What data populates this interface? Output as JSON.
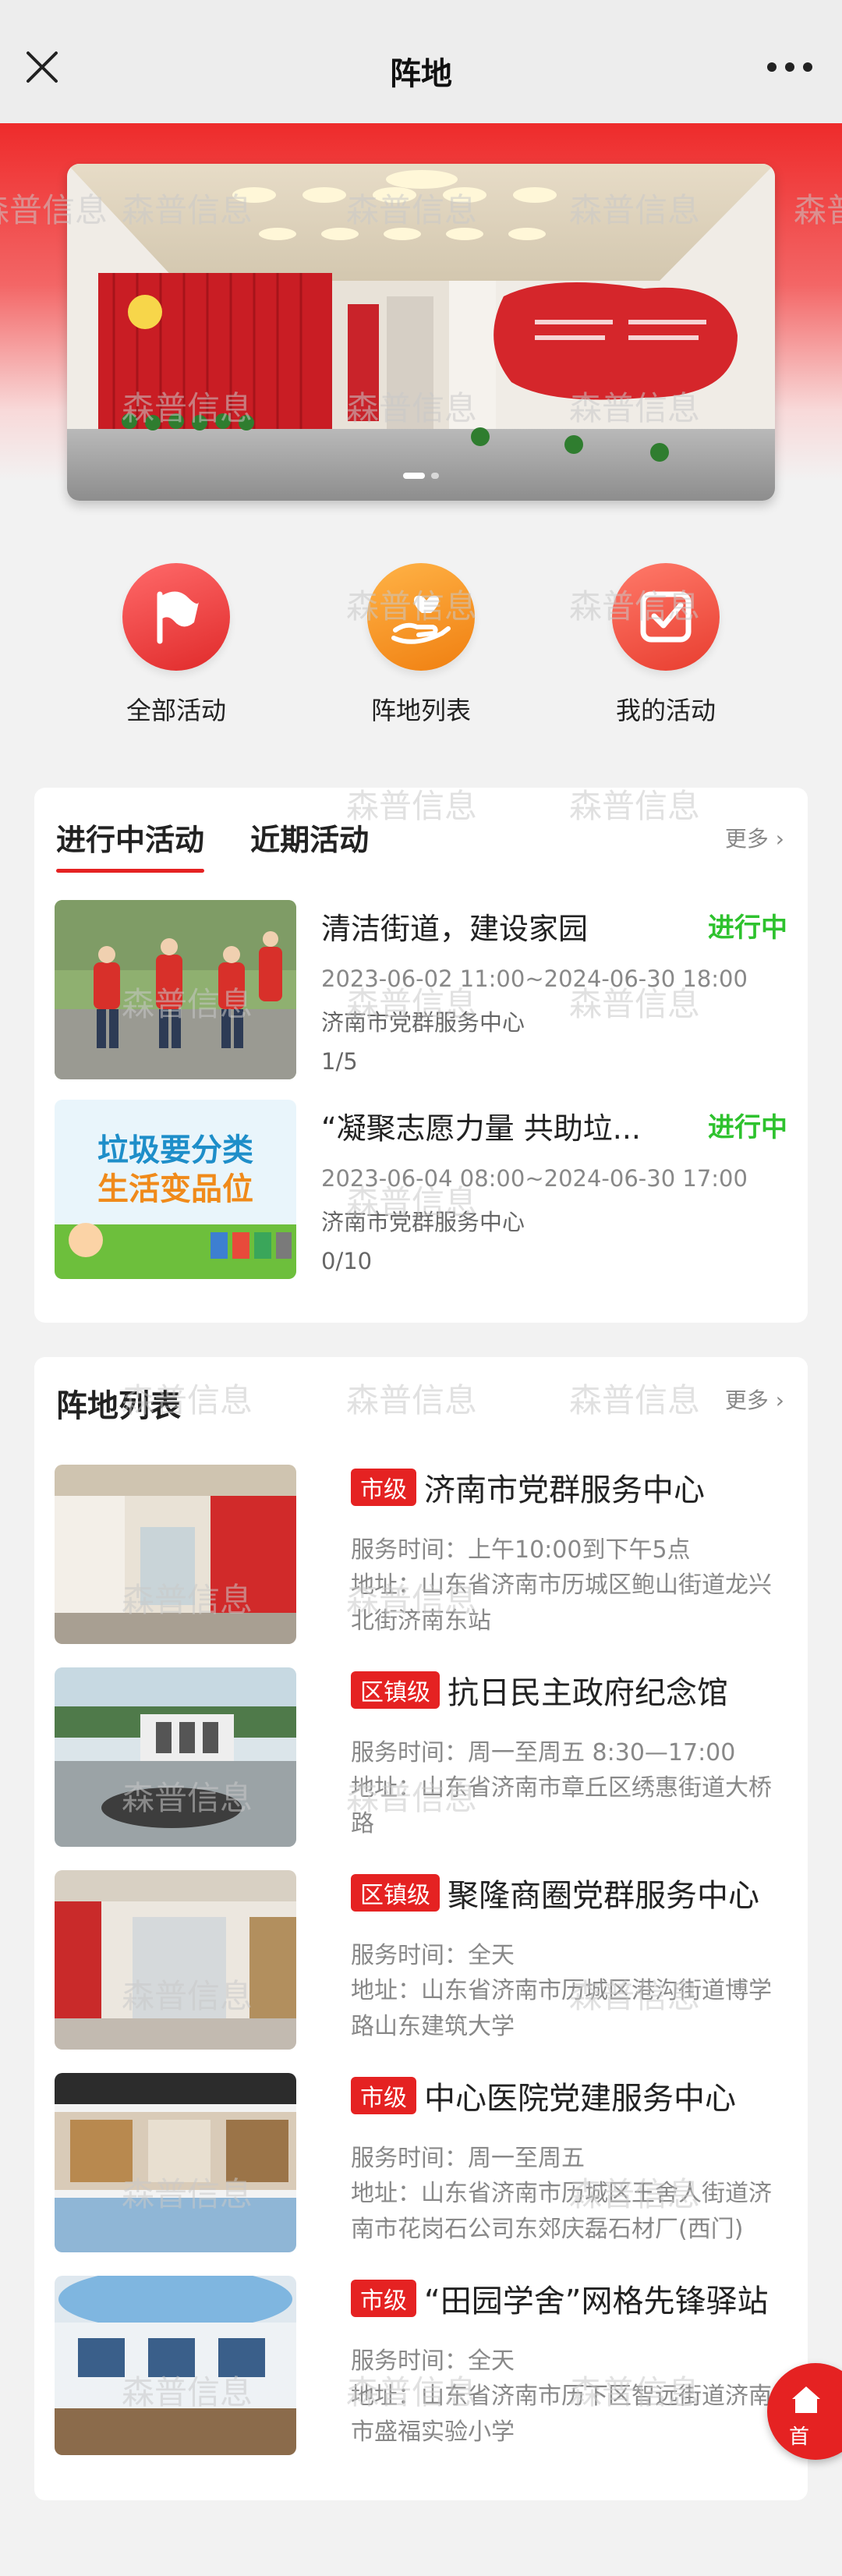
{
  "nav": {
    "title": "阵地"
  },
  "watermark": {
    "text": "森普信息"
  },
  "banner": {
    "dot_count": 2,
    "active_dot": 0
  },
  "quick": [
    {
      "label": "全部活动",
      "icon": "flag-icon",
      "color": "#f04a4a"
    },
    {
      "label": "阵地列表",
      "icon": "hand-heart-icon",
      "color": "#f5951f"
    },
    {
      "label": "我的活动",
      "icon": "checkbox-icon",
      "color": "#f05a4a"
    }
  ],
  "activities": {
    "tabs": [
      "进行中活动",
      "近期活动"
    ],
    "more": "更多",
    "items": [
      {
        "title": "清洁街道，建设家园",
        "status": "进行中",
        "time": "2023-06-02 11:00~2024-06-30 18:00",
        "place": "济南市党群服务中心",
        "count": "1/5"
      },
      {
        "title": "“凝聚志愿力量 共助垃...",
        "status": "进行中",
        "time": "2023-06-04 08:00~2024-06-30 17:00",
        "place": "济南市党群服务中心",
        "count": "0/10",
        "image_text": [
          "垃圾要分类",
          "生活变品位"
        ]
      }
    ]
  },
  "positions": {
    "title": "阵地列表",
    "more": "更多",
    "items": [
      {
        "badge": "市级",
        "name": "济南市党群服务中心",
        "hours": "服务时间：上午10:00到下午5点",
        "address": "地址：山东省济南市历城区鲍山街道龙兴北街济南东站"
      },
      {
        "badge": "区镇级",
        "name": "抗日民主政府纪念馆",
        "hours": "服务时间：周一至周五 8:30—17:00",
        "address": "地址：山东省济南市章丘区绣惠街道大桥路"
      },
      {
        "badge": "区镇级",
        "name": "聚隆商圈党群服务中心",
        "hours": "服务时间：全天",
        "address": "地址：山东省济南市历城区港沟街道博学路山东建筑大学"
      },
      {
        "badge": "市级",
        "name": "中心医院党建服务中心",
        "hours": "服务时间：周一至周五",
        "address": "地址：山东省济南市历城区王舍人街道济南市花岗石公司东郊庆磊石材厂(西门)"
      },
      {
        "badge": "市级",
        "name": "“田园学舍”网格先锋驿站",
        "hours": "服务时间：全天",
        "address": "地址：山东省济南市历下区智远街道济南市盛福实验小学"
      }
    ]
  },
  "float": {
    "label": "首"
  }
}
